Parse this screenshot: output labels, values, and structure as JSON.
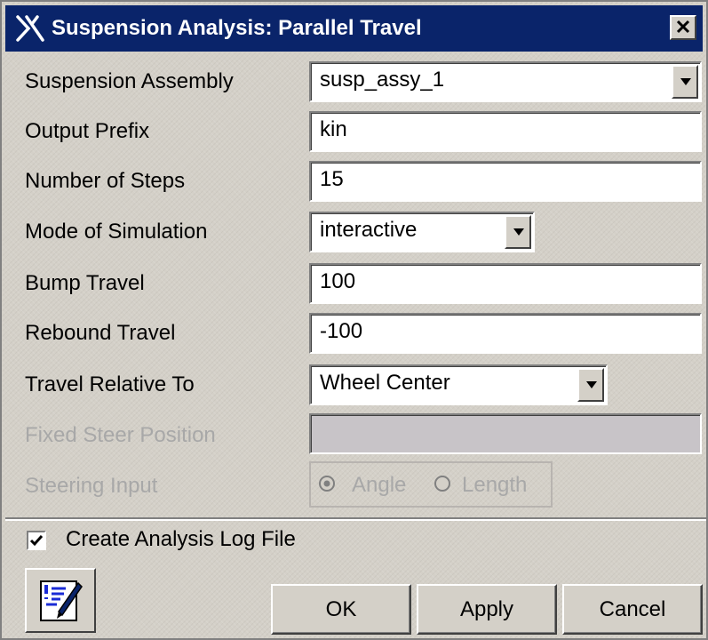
{
  "window": {
    "title": "Suspension Analysis: Parallel Travel",
    "close_label": "×"
  },
  "form": {
    "suspension_assembly": {
      "label": "Suspension Assembly",
      "value": "susp_assy_1"
    },
    "output_prefix": {
      "label": "Output Prefix",
      "value": "kin"
    },
    "number_of_steps": {
      "label": "Number of Steps",
      "value": "15"
    },
    "mode_of_simulation": {
      "label": "Mode of Simulation",
      "value": "interactive"
    },
    "bump_travel": {
      "label": "Bump Travel",
      "value": "100"
    },
    "rebound_travel": {
      "label": "Rebound Travel",
      "value": "-100"
    },
    "travel_relative_to": {
      "label": "Travel Relative To",
      "value": "Wheel Center"
    },
    "fixed_steer_position": {
      "label": "Fixed Steer Position",
      "value": "",
      "enabled": false
    },
    "steering_input": {
      "label": "Steering Input",
      "enabled": false,
      "options": [
        "Angle",
        "Length"
      ],
      "selected": "Angle"
    }
  },
  "log_file": {
    "label": "Create Analysis Log File",
    "checked": true
  },
  "buttons": {
    "ok": "OK",
    "apply": "Apply",
    "cancel": "Cancel",
    "comments_icon": "edit-comments-icon"
  },
  "colors": {
    "titlebar": "#0a246a",
    "dialog_bg": "#d4d0c8",
    "disabled_text": "#a8a8a8",
    "disabled_field": "#c8c4c8"
  }
}
